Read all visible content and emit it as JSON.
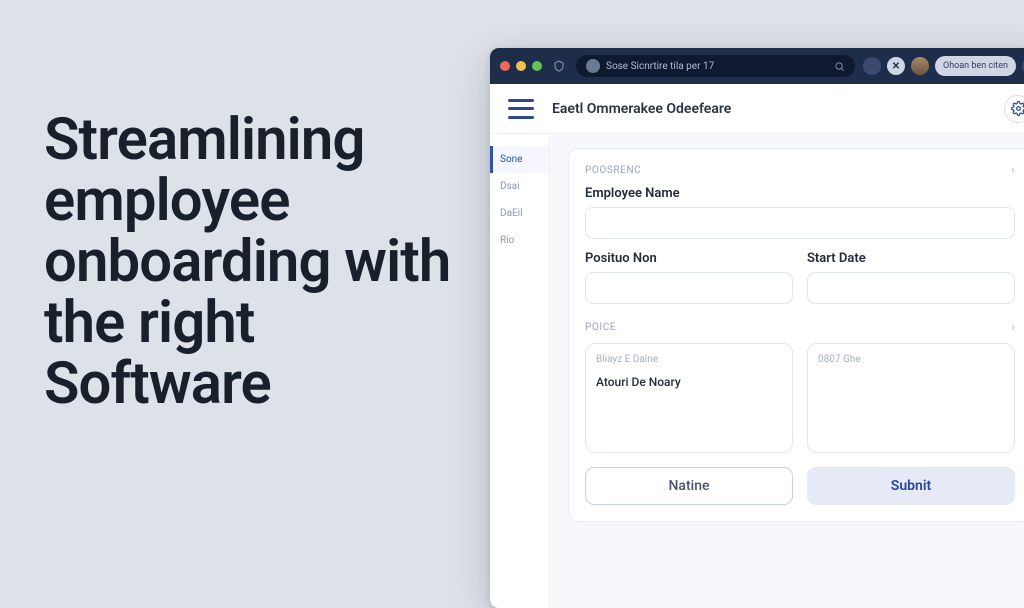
{
  "marketing": {
    "headline": "Streamlining employee onboarding with the right Software"
  },
  "browser": {
    "address_text": "Sose Sicnrtire tila per 17",
    "action_label": "Ohoan ben citen"
  },
  "app": {
    "title": "Eaetl Ommerakee Odeefeare"
  },
  "sidebar": {
    "items": [
      {
        "label": "Sone"
      },
      {
        "label": "Dsai"
      },
      {
        "label": "DaEil"
      },
      {
        "label": "Rio"
      }
    ]
  },
  "form": {
    "section1_label": "POOSRENC",
    "employee_name": {
      "label": "Employee Name",
      "value": ""
    },
    "position": {
      "label": "Posituo Non",
      "value": ""
    },
    "start_date": {
      "label": "Start Date",
      "value": ""
    },
    "section2_label": "POICE",
    "left_box": {
      "hint": "Bliayz E Dalne",
      "entry": "Atouri De Noary"
    },
    "right_box": {
      "hint": "0807 Ghe"
    },
    "buttons": {
      "secondary": "Natine",
      "primary": "Subnit"
    }
  }
}
